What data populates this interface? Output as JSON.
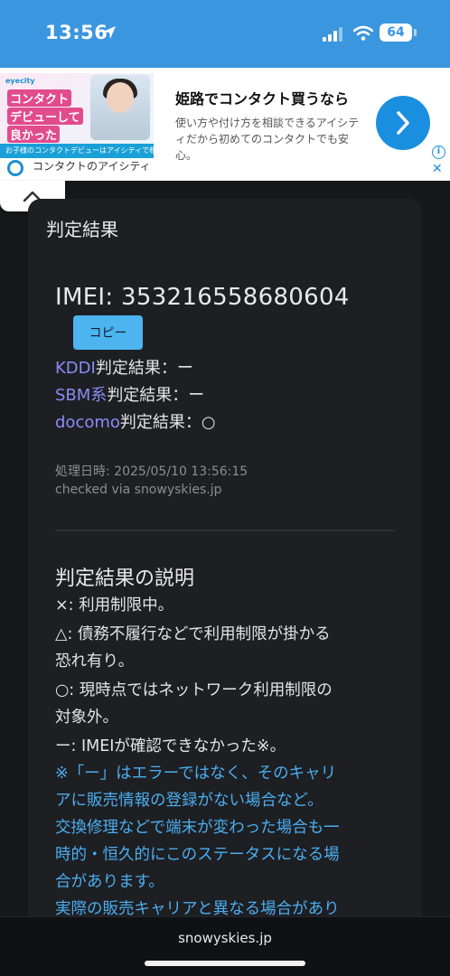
{
  "status_bar": {
    "time": "13:56",
    "battery": "64"
  },
  "ad": {
    "image_brand": "eyecity",
    "image_lines": [
      "コンタクト",
      "デビューして",
      "良かった"
    ],
    "image_bottom": "お子様のコンタクトデビューはアイシティで相談",
    "brand": "コンタクトのアイシティ",
    "title": "姫路でコンタクト買うなら",
    "description": "使い方や付け方を相談できるアイシティだから初めてのコンタクトでも安心。"
  },
  "main": {
    "heading": "判定結果",
    "imei_text": "IMEI: 353216558680604",
    "copy_label": "コピー",
    "results": [
      {
        "carrier": "KDDI",
        "text": "判定結果：ー"
      },
      {
        "carrier": "SBM系",
        "text": "判定結果：ー"
      },
      {
        "carrier": "docomo",
        "text": "判定結果：○"
      }
    ],
    "processed": "処理日時: 2025/05/10 13:56:15",
    "checked_via": "checked via snowyskies.jp",
    "explanation_title": "判定結果の説明",
    "explanation_lines": [
      "×: 利用制限中。",
      "△: 債務不履行などで利用制限が掛かる",
      "恐れ有り。",
      "○: 現時点ではネットワーク利用制限の",
      "対象外。",
      "ー: IMEIが確認できなかった※。"
    ],
    "note_lines": [
      "※「ー」はエラーではなく、そのキャリ",
      "アに販売情報の登録がない場合など。",
      "交換修理などで端末が変わった場合も一",
      "時的・恒久的にこのステータスになる場",
      "合があります。",
      "実際の販売キャリアと異なる場合があり"
    ]
  },
  "footer": {
    "domain": "snowyskies.jp"
  },
  "colors": {
    "accent": "#3a96de",
    "link": "#8a8cf5",
    "note": "#4aaef0",
    "copy_button": "#4cb4ef"
  }
}
